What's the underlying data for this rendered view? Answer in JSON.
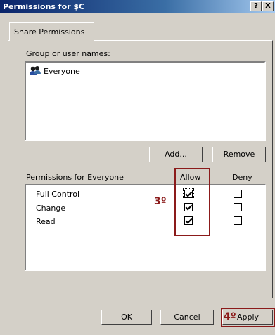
{
  "window": {
    "title": "Permissions for $C",
    "help_label": "?",
    "close_label": "X"
  },
  "tabs": [
    {
      "label": "Share Permissions"
    }
  ],
  "group_section": {
    "label": "Group or user names:",
    "users": [
      {
        "name": "Everyone",
        "icon": "users-icon"
      }
    ],
    "add_label": "Add...",
    "remove_label": "Remove"
  },
  "permissions": {
    "label": "Permissions for Everyone",
    "allow_header": "Allow",
    "deny_header": "Deny",
    "rows": [
      {
        "name": "Full Control",
        "allow": true,
        "deny": false
      },
      {
        "name": "Change",
        "allow": true,
        "deny": false
      },
      {
        "name": "Read",
        "allow": true,
        "deny": false
      }
    ]
  },
  "annotations": {
    "step3": "3º",
    "step4": "4º"
  },
  "footer": {
    "ok_label": "OK",
    "cancel_label": "Cancel",
    "apply_label": "Apply"
  }
}
